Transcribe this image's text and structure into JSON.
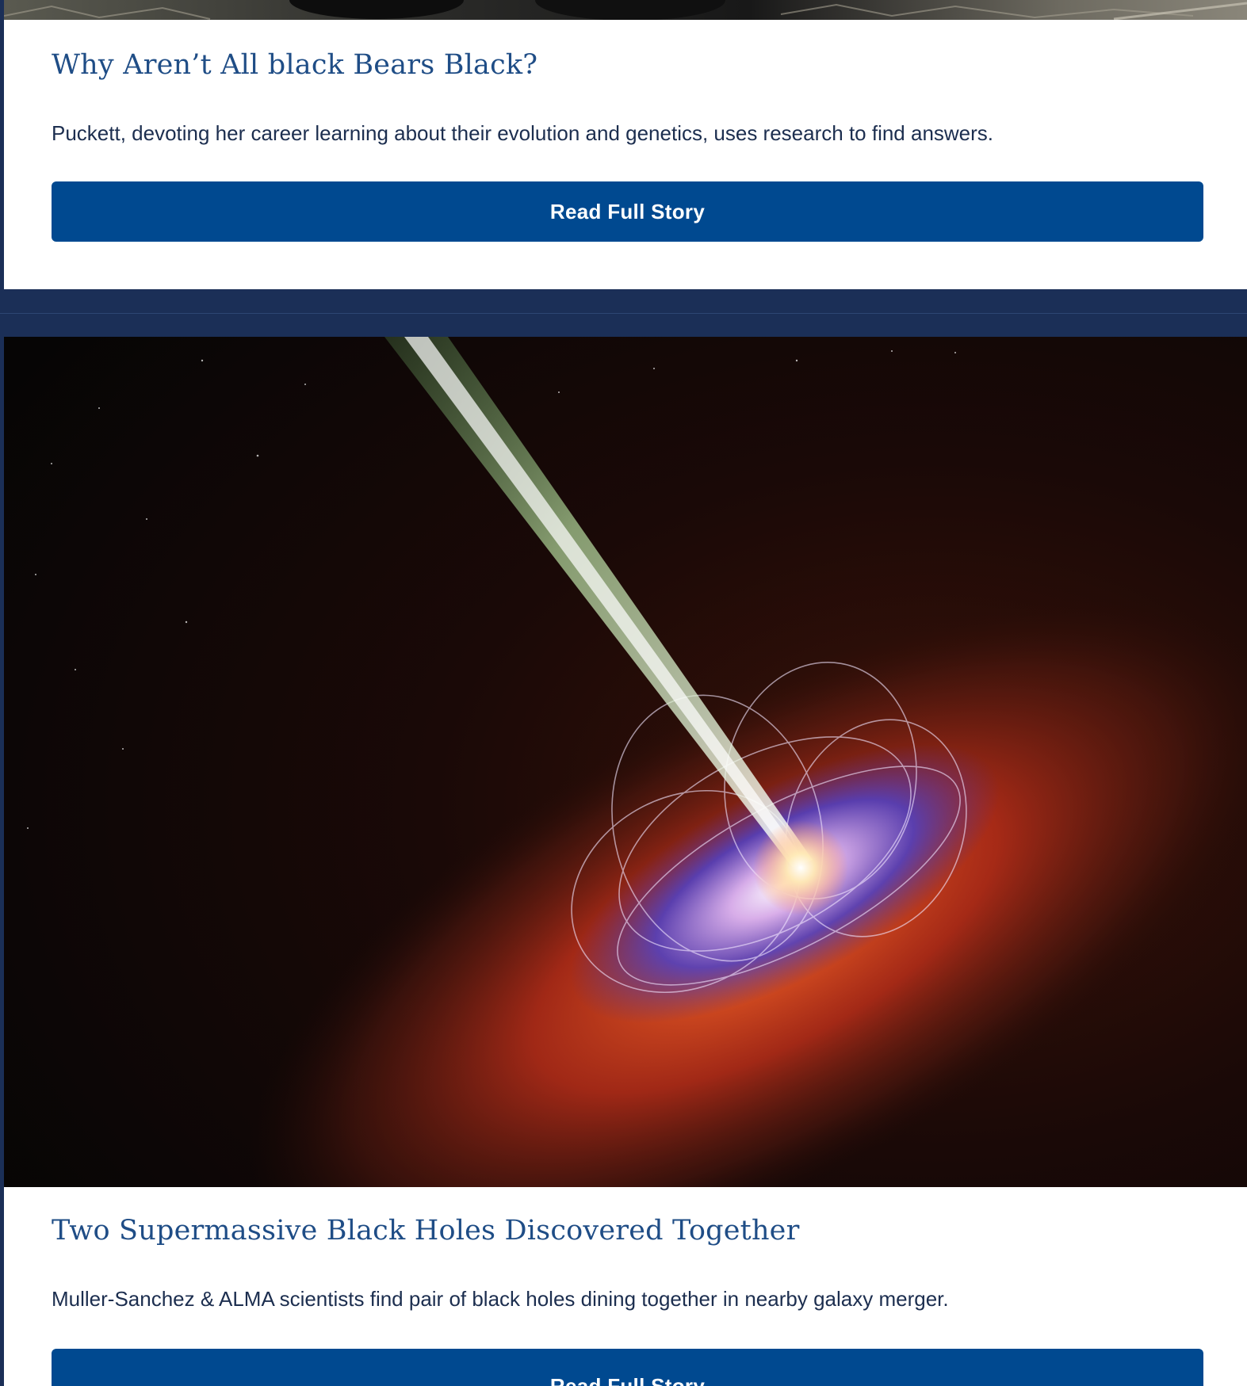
{
  "stories": [
    {
      "image_icon": "black-bears-photo",
      "title": "Why Aren’t All black Bears Black?",
      "description": "Puckett, devoting her career learning about their evolution and genetics, uses research to find answers.",
      "button_label": "Read Full Story"
    },
    {
      "image_icon": "black-hole-illustration",
      "title": "Two Supermassive Black Holes Discovered Together",
      "description": "Muller-Sanchez & ALMA scientists find pair of black holes dining together in nearby galaxy merger.",
      "button_label": "Read Full Story"
    }
  ],
  "colors": {
    "page_background": "#1b2f57",
    "title": "#1f4d86",
    "button": "#004990",
    "text": "#1c2e4f"
  }
}
